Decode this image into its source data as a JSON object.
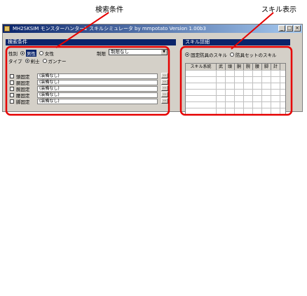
{
  "callouts": {
    "search_conditions": "検索条件",
    "skill_display": "スキル表示"
  },
  "window": {
    "title": "MH2SKSIM  モンスターハンター2 スキルシミュレータ  by mmpotato Version 1.00b3",
    "buttons": [
      "_",
      "□",
      "×"
    ]
  },
  "search_panel": {
    "title": "検索条件",
    "gender_label": "性別",
    "gender_options": [
      "男性",
      "女性"
    ],
    "gender_selected": "男性",
    "limit_label": "制限",
    "limit_value": "制限なし",
    "type_label": "タイプ",
    "type_options": [
      "剣士",
      "ガンナー"
    ],
    "type_selected": "剣士",
    "equipment": [
      {
        "label": "頭固定",
        "value": "(装備なし)"
      },
      {
        "label": "胴固定",
        "value": "(装備なし)"
      },
      {
        "label": "腕固定",
        "value": "(装備なし)"
      },
      {
        "label": "腰固定",
        "value": "(装備なし)"
      },
      {
        "label": "脚固定",
        "value": "(装備なし)"
      }
    ],
    "browse_label": "..."
  },
  "skill_panel": {
    "title": "スキル詳細",
    "mode_options": [
      "固定防具のスキル",
      "防具セットのスキル"
    ],
    "mode_selected": "固定防具のスキル",
    "columns": [
      "スキル系統",
      "武",
      "頭",
      "胴",
      "腕",
      "腰",
      "脚",
      "計"
    ]
  },
  "colors": {
    "highlight": "#e60000",
    "title_bar": "#0a246a"
  }
}
